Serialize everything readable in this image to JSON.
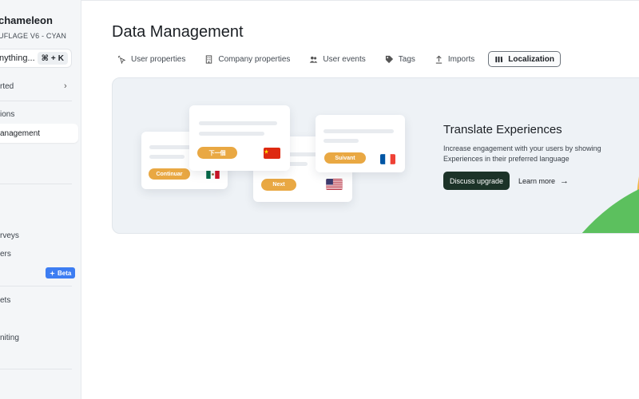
{
  "sidebar": {
    "brand": "chameleon",
    "environment": "UFLAGE V6 - CYAN",
    "search": {
      "placeholder": "nything...",
      "shortcut_mod": "⌘",
      "shortcut_plus": "+",
      "shortcut_key": "K"
    },
    "items": [
      {
        "label": "rted"
      },
      {
        "label": "ions"
      },
      {
        "label": "anagement"
      },
      {
        "label": ""
      },
      {
        "label": "rveys"
      },
      {
        "label": "ers"
      },
      {
        "label": ""
      },
      {
        "label": "ets"
      },
      {
        "label": "niting"
      }
    ],
    "beta_label": "Beta"
  },
  "page": {
    "title": "Data Management"
  },
  "tabs": [
    {
      "label": "User properties",
      "icon": "cursor-click-icon"
    },
    {
      "label": "Company properties",
      "icon": "building-icon"
    },
    {
      "label": "User events",
      "icon": "users-icon"
    },
    {
      "label": "Tags",
      "icon": "tag-icon"
    },
    {
      "label": "Imports",
      "icon": "upload-icon"
    },
    {
      "label": "Localization",
      "icon": "localization-icon",
      "active": true
    }
  ],
  "promo": {
    "title": "Translate Experiences",
    "description": "Increase engagement with your users by showing Experiences in their preferred language",
    "primary_button": "Discuss upgrade",
    "secondary_link": "Learn more",
    "illustration_buttons": {
      "spanish": "Continuar",
      "chinese": "下一個",
      "english": "Next",
      "french": "Suivant"
    }
  },
  "colors": {
    "accent_orange": "#e9a843",
    "dark_button": "#1c3328",
    "decor_green": "#5cc05e",
    "decor_yellow": "#f0b84a"
  }
}
